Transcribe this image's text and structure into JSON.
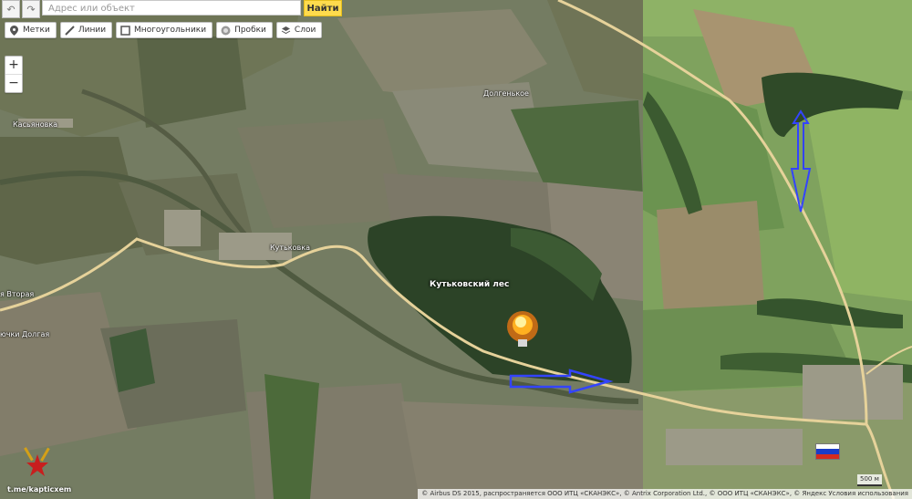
{
  "toolbar": {
    "back_icon": "back-arrow-icon",
    "forward_icon": "forward-arrow-icon",
    "search_placeholder": "Адрес или объект",
    "search_button": "Найти"
  },
  "tools": [
    {
      "label": "Метки",
      "icon": "placemark-icon"
    },
    {
      "label": "Линии",
      "icon": "line-icon"
    },
    {
      "label": "Многоугольники",
      "icon": "polygon-icon"
    },
    {
      "label": "Пробки",
      "icon": "traffic-icon"
    },
    {
      "label": "Слои",
      "icon": "layers-icon"
    }
  ],
  "zoom": {
    "in": "+",
    "out": "−"
  },
  "places": {
    "kasyanovka": "Касьяновка",
    "dolgenkoe": "Долгенькое",
    "kutkovka": "Кутьковка",
    "vtoraya": "я Вторая",
    "forest": "Кутьковский лес",
    "bottom_left": "ючки Долгая"
  },
  "scale": "500 м",
  "copyright": "© Airbus DS 2015, распространяется ООО ИТЦ «СКАНЭКС», © Antrix Corporation Ltd., © ООО ИТЦ «СКАНЭКС», © Яндекс Условия использования",
  "watermark": "t.me/kapticxem",
  "colors": {
    "search_button": "#ffdb4d",
    "road": "#e6d29a",
    "arrow": "#3344ff",
    "explosion": "#ffb020"
  }
}
